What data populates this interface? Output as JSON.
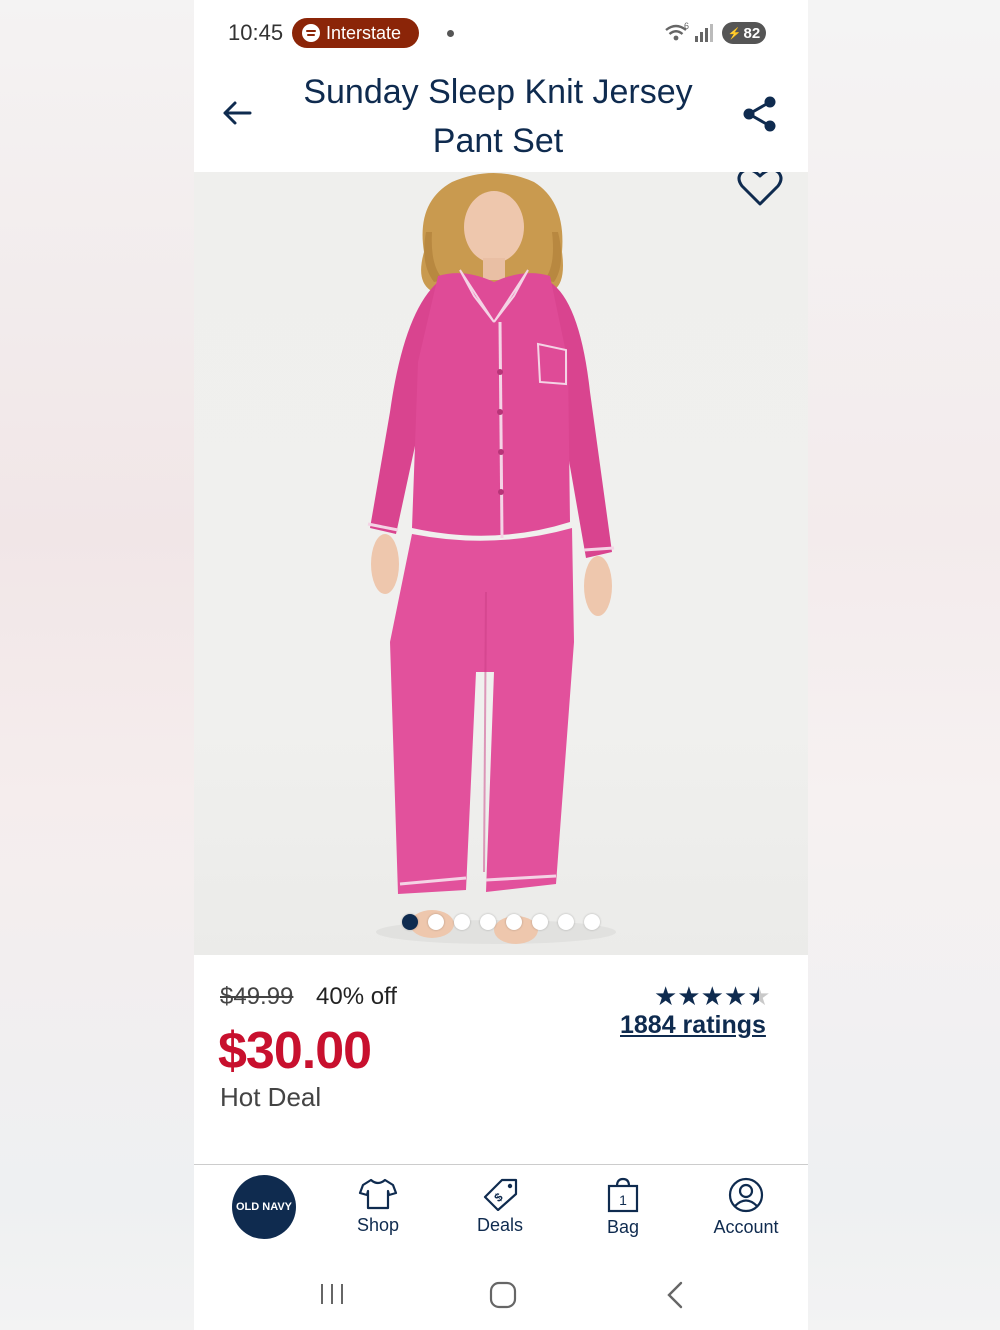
{
  "status_bar": {
    "time": "10:45",
    "media_app": "Interstate",
    "network": "6",
    "battery": "82"
  },
  "header": {
    "title": "Sunday Sleep Knit Jersey Pant Set"
  },
  "gallery": {
    "image_count": 8,
    "active_index": 0
  },
  "pricing": {
    "original_price": "$49.99",
    "discount": "40% off",
    "current_price": "$30.00",
    "deal_label": "Hot Deal",
    "star_rating": 4.5,
    "stars_text": "★★★★",
    "ratings_link": "1884 ratings"
  },
  "bottom_nav": {
    "logo": "OLD NAVY",
    "items": [
      {
        "label": "Shop",
        "icon": "tshirt-icon"
      },
      {
        "label": "Deals",
        "icon": "price-tag-icon"
      },
      {
        "label": "Bag",
        "icon": "shopping-bag-icon",
        "badge": "1"
      },
      {
        "label": "Account",
        "icon": "user-icon"
      }
    ]
  },
  "colors": {
    "brand_navy": "#0f2b4f",
    "sale_red": "#c8102e",
    "product_pink": "#e0489a",
    "spotify_pill": "#8b2508"
  }
}
